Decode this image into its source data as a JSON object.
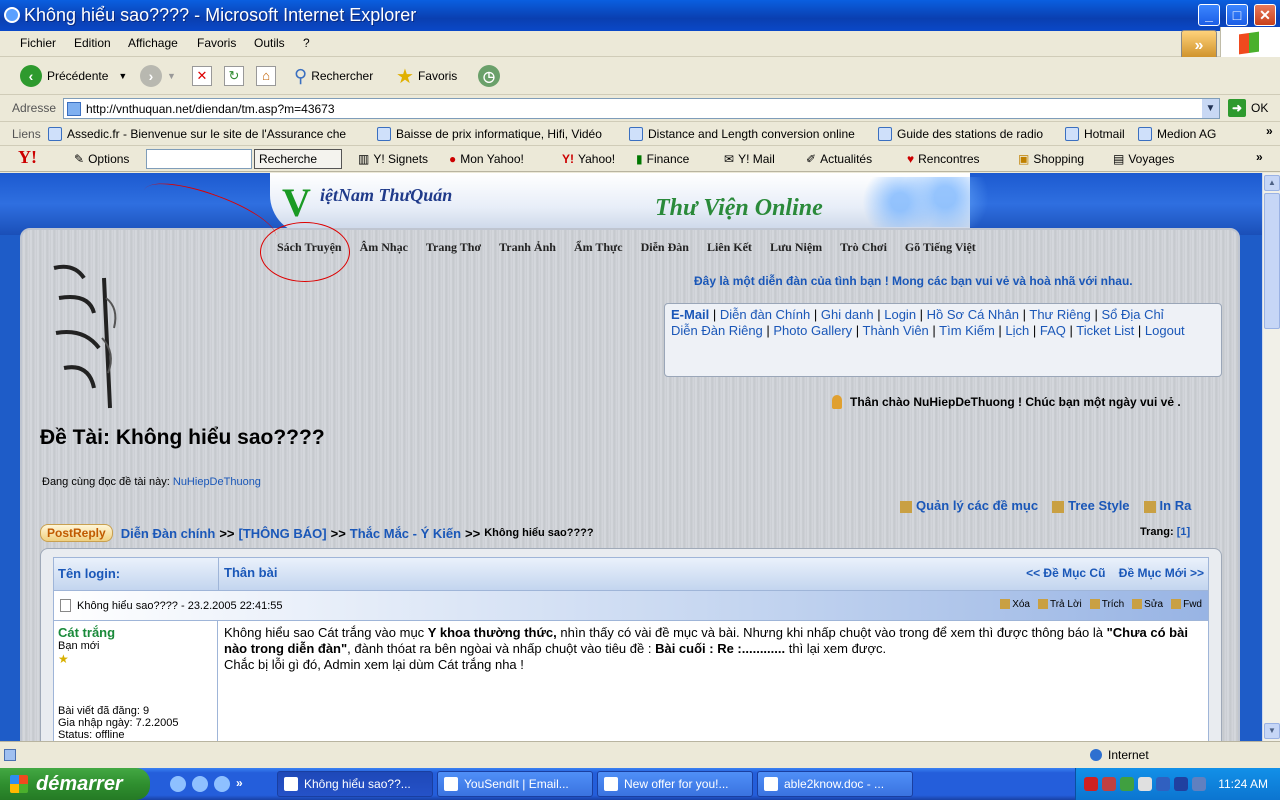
{
  "window": {
    "title": "Không hiểu sao???? - Microsoft Internet Explorer",
    "min": "_",
    "max": "□",
    "close": "✕"
  },
  "menu": [
    "Fichier",
    "Edition",
    "Affichage",
    "Favoris",
    "Outils",
    "?"
  ],
  "toolbar": {
    "back": "Précédente",
    "search": "Rechercher",
    "favorites": "Favoris"
  },
  "address": {
    "label": "Adresse",
    "url": "http://vnthuquan.net/diendan/tm.asp?m=43673",
    "go": "OK"
  },
  "links": {
    "label": "Liens",
    "items": [
      "Assedic.fr - Bienvenue sur le site de l'Assurance che",
      "Baisse de prix informatique, Hifi, Vidéo",
      "Distance and Length conversion online",
      "Guide des stations de radio",
      "Hotmail",
      "Medion AG"
    ]
  },
  "yahoo": {
    "logo": "Y!",
    "options": "Options",
    "search_btn": "Recherche",
    "items": [
      "Y! Signets",
      "Mon Yahoo!",
      "Yahoo!",
      "Finance",
      "Y! Mail",
      "Actualités",
      "Rencontres",
      "Shopping",
      "Voyages"
    ]
  },
  "banner": {
    "site": "iệtNam ThưQuán",
    "library": "Thư Viện Online"
  },
  "nav": [
    "Sách Truyện",
    "Âm Nhạc",
    "Trang Thơ",
    "Tranh Ảnh",
    "Ẩm Thực",
    "Diễn Đàn",
    "Liên Kết",
    "Lưu Niệm",
    "Trò Chơi",
    "Gõ Tiếng Việt"
  ],
  "welcome_top": "Đây là một diễn đàn của tình bạn ! Mong các bạn vui vẻ và hoà nhã với nhau.",
  "linkbox": {
    "email": "E-Mail",
    "items": [
      "Diễn đàn Chính",
      "Ghi danh",
      "Login",
      "Hồ Sơ Cá Nhân",
      "Thư Riêng",
      "Sổ Địa Chỉ",
      "Diễn Đàn Riêng",
      "Photo Gallery",
      "Thành Viên",
      "Tìm Kiếm",
      "Lịch",
      "FAQ",
      "Ticket List",
      "Logout"
    ]
  },
  "greeting": "Thân chào NuHiepDeThuong ! Chúc bạn một ngày vui vẻ .",
  "topic_title": "Đề Tài: Không hiểu sao????",
  "reading": {
    "label": "Đang cùng đọc đề tài này:",
    "user": "NuHiepDeThuong"
  },
  "tools": [
    "Quản lý các đề mục",
    "Tree Style",
    "In Ra"
  ],
  "crumb": {
    "postreply": "PostReply",
    "items": [
      "Diễn Đàn chính",
      "[THÔNG BÁO]",
      "Thắc Mắc - Ý Kiến"
    ],
    "sep": ">>",
    "current": "Không hiểu sao????"
  },
  "pages": {
    "label": "Trang:",
    "value": "[1]"
  },
  "post": {
    "col1": "Tên login:",
    "col2": "Thân bài",
    "prev": "<< Đề Mục Cũ",
    "next": "Đề Mục Mới >>",
    "info": "Không hiểu sao???? - 23.2.2005 22:41:55",
    "actions": [
      "Xóa",
      "Trả Lời",
      "Trích",
      "Sửa",
      "Fwd"
    ],
    "user": "Cát trắng",
    "rank": "Bạn mới",
    "star": "★",
    "posts": "Bài viết đã đăng: 9",
    "joined": "Gia nhập ngày: 7.2.2005",
    "status": "Status: offline",
    "msg": {
      "p1": "Không hiểu sao Cát trắng vào mục ",
      "b1": "Y khoa thường thức,",
      "p2": " nhìn thấy có vài đề mục và bài. Nhưng khi nhấp chuột vào trong để xem thì được thông báo là ",
      "b2": "\"Chưa có bài nào trong diễn đàn\"",
      "p3": ", đành thóat ra bên ngòai và nhấp chuột vào tiêu đề : ",
      "b3": "Bài cuối : Re :............",
      "p4": " thì lại xem được.",
      "line2": "Chắc bị lỗi gì đó, Admin xem lại dùm Cát trắng nha !"
    }
  },
  "status": {
    "zone": "Internet"
  },
  "taskbar": {
    "start": "démarrer",
    "buttons": [
      "Không hiểu sao??...",
      "YouSendIt | Email...",
      "New offer for you!...",
      "able2know.doc - ..."
    ],
    "clock": "11:24 AM"
  }
}
